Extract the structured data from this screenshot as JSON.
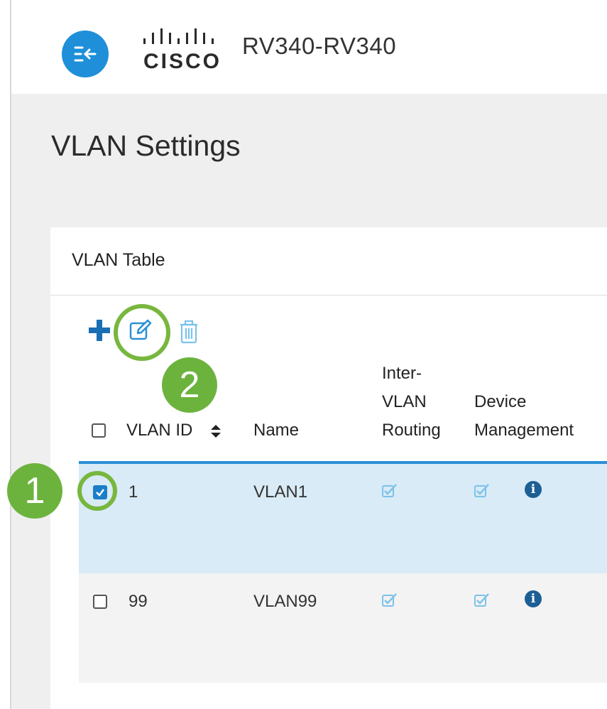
{
  "header": {
    "device_name": "RV340-RV340",
    "logo_text": "CISCO",
    "nav_icon": "collapse-nav-icon"
  },
  "page": {
    "title": "VLAN Settings"
  },
  "card": {
    "title": "VLAN Table",
    "toolbar": {
      "add_icon": "plus-icon",
      "edit_icon": "edit-icon",
      "delete_icon": "trash-icon"
    }
  },
  "table": {
    "columns": {
      "vlan_id": "VLAN ID",
      "name": "Name",
      "inter_vlan_routing_1": "Inter-",
      "inter_vlan_routing_2": "VLAN",
      "inter_vlan_routing_3": "Routing",
      "device_management_1": "Device",
      "device_management_2": "Management"
    },
    "rows": [
      {
        "selected": true,
        "vlan_id": "1",
        "name": "VLAN1",
        "inter_vlan_routing": true,
        "device_management": true
      },
      {
        "selected": false,
        "vlan_id": "99",
        "name": "VLAN99",
        "inter_vlan_routing": true,
        "device_management": true
      }
    ]
  },
  "annotations": {
    "step_1": "1",
    "step_2": "2"
  },
  "colors": {
    "accent_blue": "#1e8fd8",
    "selected_row": "#d8ebf6",
    "callout_green": "#6cb33e"
  }
}
